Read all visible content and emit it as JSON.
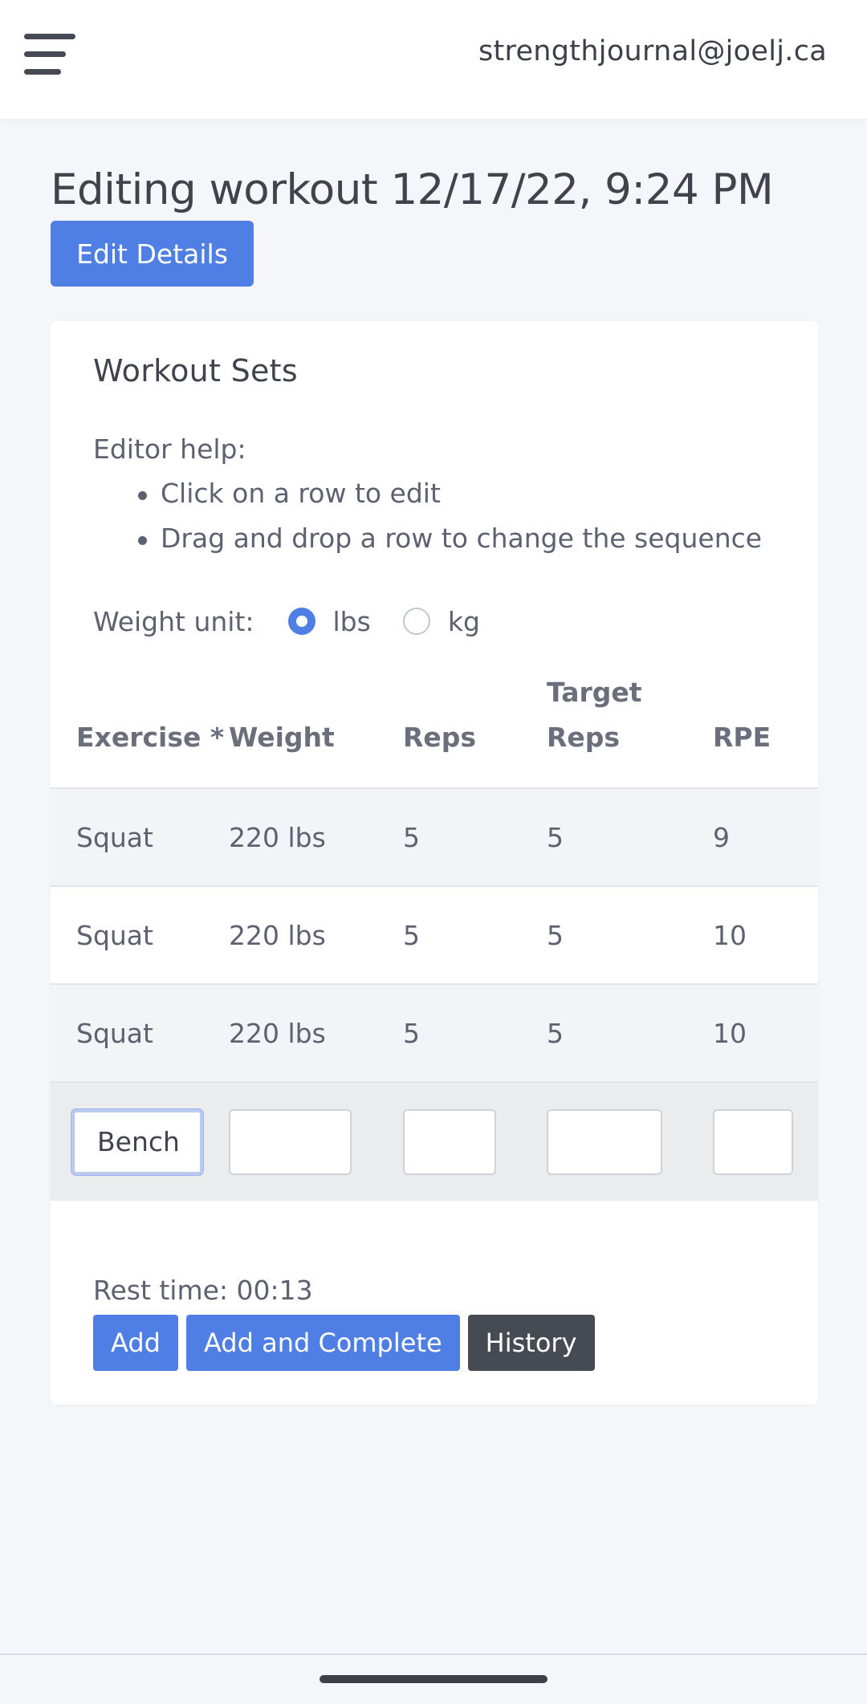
{
  "header": {
    "menu_icon": "hamburger-menu-icon",
    "user_email": "strengthjournal@joelj.ca"
  },
  "page": {
    "title": "Editing workout 12/17/22, 9:24 PM",
    "edit_details_label": "Edit Details"
  },
  "card": {
    "title": "Workout Sets",
    "help_label": "Editor help:",
    "help_items": [
      "Click on a row to edit",
      "Drag and drop a row to change the sequence"
    ],
    "weight_unit_label": "Weight unit:",
    "unit_options": [
      {
        "label": "lbs",
        "selected": true
      },
      {
        "label": "kg",
        "selected": false
      }
    ],
    "table": {
      "headers": [
        "Exercise *",
        "Weight",
        "Reps",
        "Target Reps",
        "RPE"
      ],
      "rows": [
        [
          "Squat",
          "220 lbs",
          "5",
          "5",
          "9"
        ],
        [
          "Squat",
          "220 lbs",
          "5",
          "5",
          "10"
        ],
        [
          "Squat",
          "220 lbs",
          "5",
          "5",
          "10"
        ]
      ],
      "edit_row": {
        "exercise": "Bench",
        "weight": "",
        "reps": "",
        "target_reps": "",
        "rpe": ""
      }
    },
    "rest_time": "Rest time: 00:13",
    "buttons": {
      "add": "Add",
      "add_complete": "Add and Complete",
      "history": "History"
    }
  },
  "colors": {
    "primary": "#4f7fe4",
    "dark_button": "#464a52",
    "background": "#f5f6fa"
  }
}
